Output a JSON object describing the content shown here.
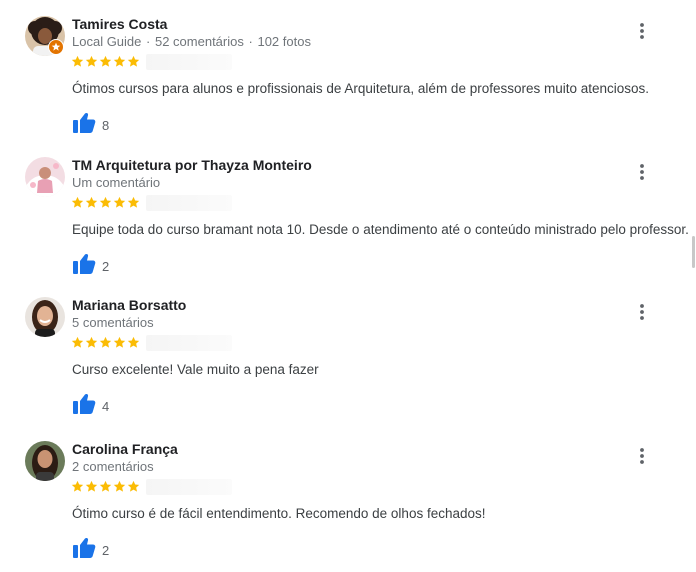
{
  "reviews": [
    {
      "author": "Tamires Costa",
      "badge": "Local Guide",
      "sep1": "·",
      "reviews_count": "52 comentários",
      "sep2": "·",
      "photos_count": "102 fotos",
      "rating": 5,
      "text": "Ótimos cursos para alunos e profissionais de Arquitetura, além de professores muito atenciosos.",
      "likes": "8",
      "avatar_icon": "person-avatar-dark-hair",
      "local_guide_icon": "local-guide-badge-icon"
    },
    {
      "author": "TM Arquitetura por Thayza Monteiro",
      "reviews_count": "Um comentário",
      "rating": 5,
      "text": "Equipe toda do curso bramant nota 10. Desde o atendimento até o conteúdo ministrado pelo professor.",
      "likes": "2",
      "avatar_icon": "person-avatar-pink"
    },
    {
      "author": "Mariana Borsatto",
      "reviews_count": "5 comentários",
      "rating": 5,
      "text": "Curso excelente! Vale muito a pena fazer",
      "likes": "4",
      "avatar_icon": "person-avatar-smiling"
    },
    {
      "author": "Carolina França",
      "reviews_count": "2 comentários",
      "rating": 5,
      "text": "Ótimo curso é de fácil entendimento. Recomendo de olhos fechados!",
      "likes": "2",
      "avatar_icon": "person-avatar-long-hair"
    }
  ],
  "colors": {
    "star": "#fbbc04",
    "thumb": "#1a73e8",
    "meta": "#70757a",
    "guide_badge": "#e37400"
  },
  "icons": {
    "star": "star-icon",
    "like": "thumbs-up-icon",
    "more": "more-vertical-icon"
  }
}
